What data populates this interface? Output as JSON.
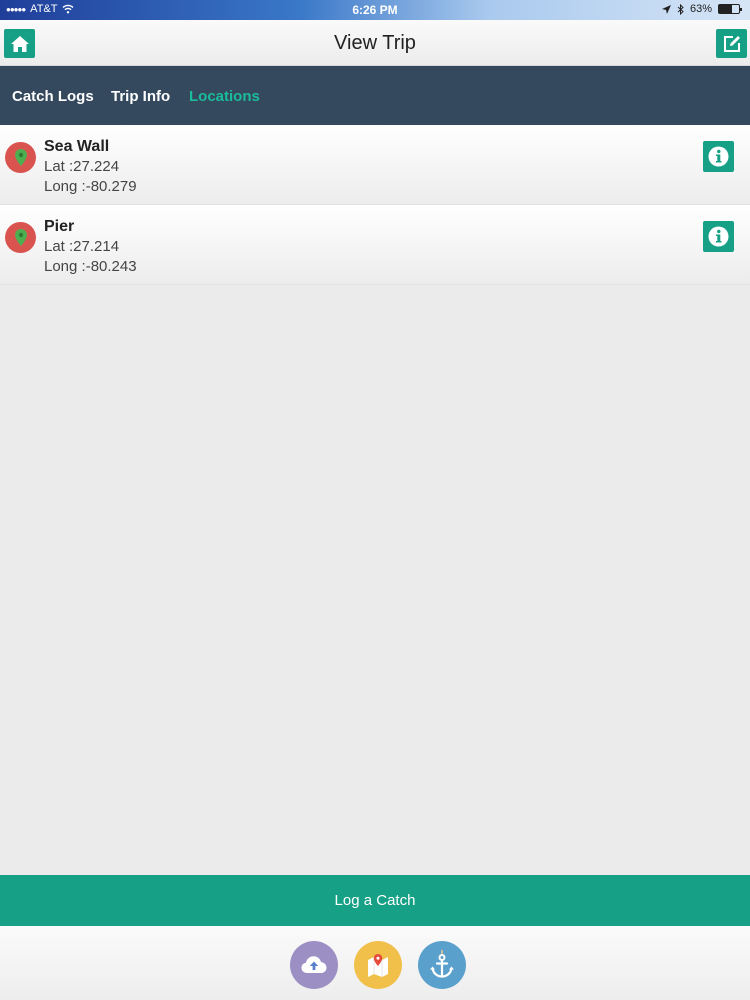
{
  "status": {
    "carrier": "AT&T",
    "time": "6:26 PM",
    "battery": "63%",
    "battery_level": 0.63
  },
  "header": {
    "title": "View Trip"
  },
  "tabs": [
    {
      "label": "Catch Logs",
      "active": false
    },
    {
      "label": "Trip Info",
      "active": false
    },
    {
      "label": "Locations",
      "active": true
    }
  ],
  "locations": [
    {
      "name": "Sea Wall",
      "lat": "Lat :27.224",
      "long": "Long :-80.279"
    },
    {
      "name": "Pier",
      "lat": "Lat :27.214",
      "long": "Long :-80.243"
    }
  ],
  "actions": {
    "log_catch": "Log a Catch"
  },
  "colors": {
    "accent": "#16a085",
    "tab_bar": "#34495e",
    "active_tab": "#1abc9c",
    "pin": "#d9534f"
  },
  "icons": [
    "home-icon",
    "edit-icon",
    "map-pin-icon",
    "info-icon",
    "cloud-upload-icon",
    "map-icon",
    "anchor-icon"
  ]
}
